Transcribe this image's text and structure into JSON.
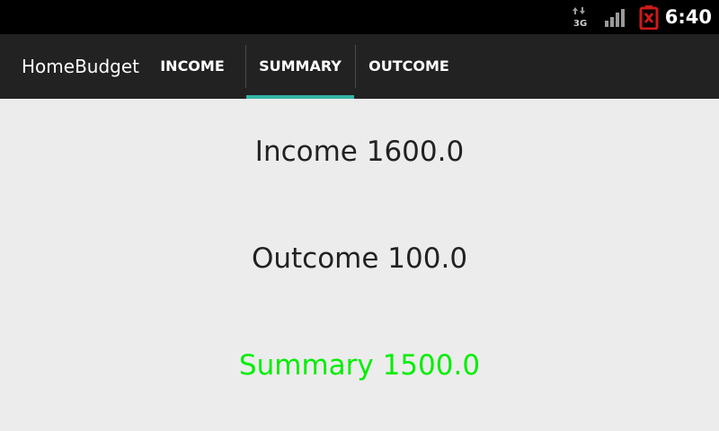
{
  "status_bar": {
    "network_type": "3G",
    "network_icon": "data-arrows-icon",
    "signal_icon": "signal-icon",
    "battery_icon": "battery-empty-icon",
    "battery_color": "#cc1a1a",
    "time": "6:40"
  },
  "action_bar": {
    "app_title": "HomeBudget",
    "tabs": [
      {
        "label": "INCOME",
        "selected": false
      },
      {
        "label": "SUMMARY",
        "selected": true
      },
      {
        "label": "OUTCOME",
        "selected": false
      }
    ],
    "indicator_color": "#33b5a5"
  },
  "content": {
    "income": {
      "label": "Income",
      "value": "1600.0",
      "text": "Income 1600.0",
      "color": "#222222"
    },
    "outcome": {
      "label": "Outcome",
      "value": "100.0",
      "text": "Outcome 100.0",
      "color": "#222222"
    },
    "summary": {
      "label": "Summary",
      "value": "1500.0",
      "text": "Summary 1500.0",
      "color": "#00ee00"
    }
  }
}
